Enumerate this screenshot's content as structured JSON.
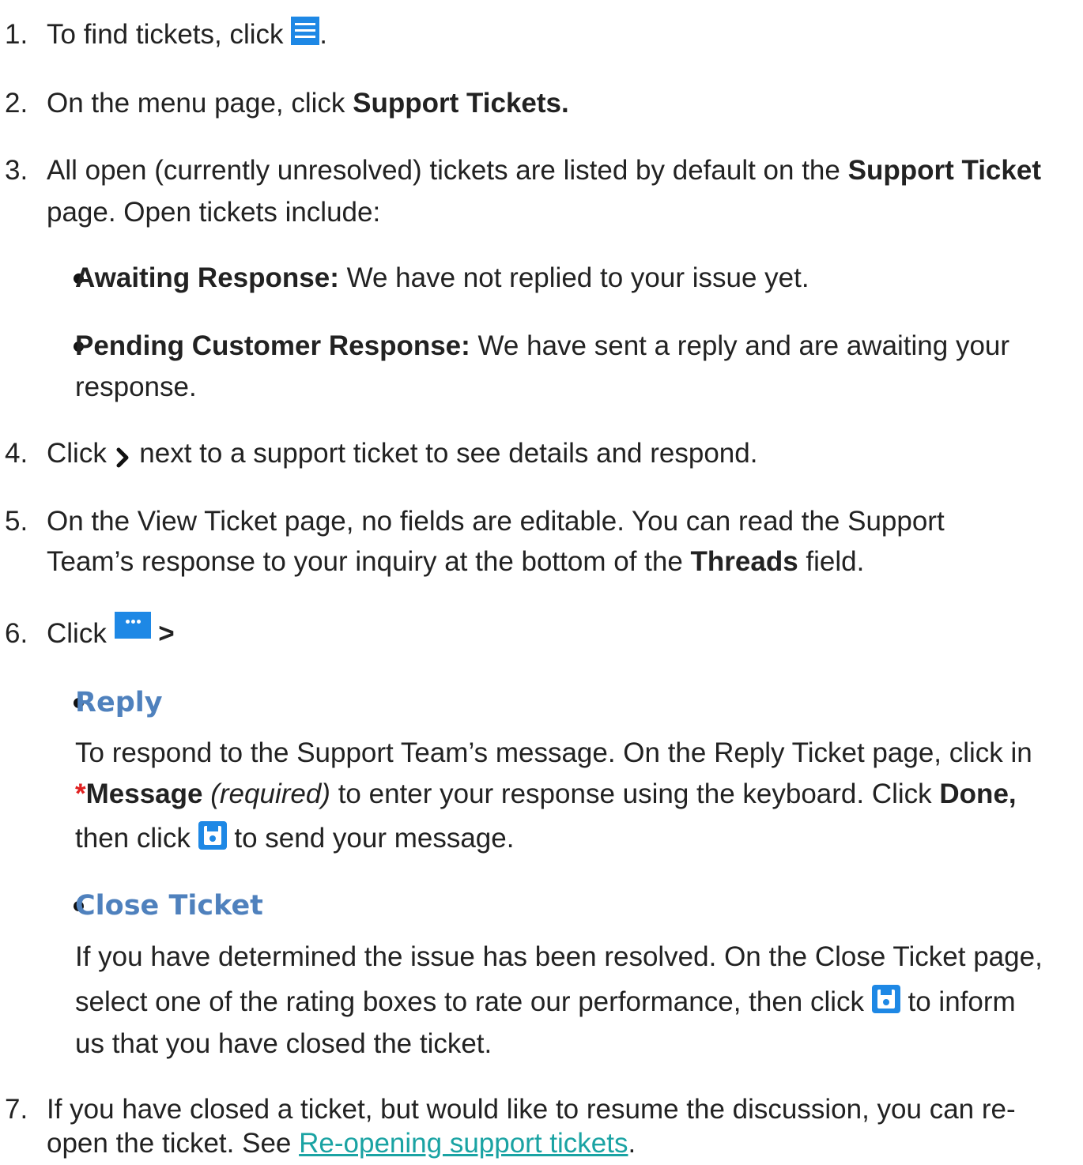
{
  "steps": {
    "s1": {
      "num": "1.",
      "text": "To find tickets, click",
      "after": "."
    },
    "s2": {
      "num": "2.",
      "text": "On the menu page, click",
      "bold": "Support Tickets."
    },
    "s3": {
      "num": "3.",
      "text": "All open (currently unresolved) tickets are listed by default on the",
      "bold": "Support Ticket",
      "line2": "page. Open tickets include:"
    },
    "s3_bullets": [
      {
        "label": "Awaiting Response:",
        "text": "We have not replied to your issue yet."
      },
      {
        "label": "Pending Customer Response:",
        "text": "We have sent a reply and are awaiting your",
        "text2": "response."
      }
    ],
    "s4": {
      "num": "4.",
      "before": "Click",
      "after": "next to a support ticket to see details and respond."
    },
    "s5": {
      "num": "5.",
      "line1": "On the View Ticket page, no fields are editable. You can read the Support",
      "line2_before": "Team’s response to your inquiry at the bottom of the",
      "bold": "Threads",
      "line2_after": "field."
    },
    "s6": {
      "num": "6.",
      "before": "Click",
      "after": ">"
    },
    "s6_reply": {
      "title": "Reply",
      "line1": "To respond to the Support Team’s message. On the Reply Ticket page, click in",
      "asterisk": "*",
      "field": "Message",
      "required": "(required)",
      "line2_mid": "to enter your response using the keyboard. Click",
      "done": "Done,",
      "line3_before": "then click",
      "line3_after": "to send your message."
    },
    "s6_close": {
      "title": "Close Ticket",
      "line1": "If you have determined the issue has been resolved. On the Close Ticket page,",
      "line2_before": "select one of the rating boxes to rate our performance, then click",
      "line2_after": "to inform",
      "line3": "us that you have closed the ticket."
    },
    "s7": {
      "num": "7.",
      "line1": "If you have closed a ticket, but would like to resume the discussion, you can re-",
      "line2_before": "open the ticket. See",
      "link": "Re-opening support tickets",
      "line2_after": "."
    }
  },
  "icons": {
    "menu": "hamburger-menu-icon",
    "chevron": "chevron-right-icon",
    "more": "more-options-icon",
    "save": "save-icon",
    "accent": "#1e88e5"
  }
}
